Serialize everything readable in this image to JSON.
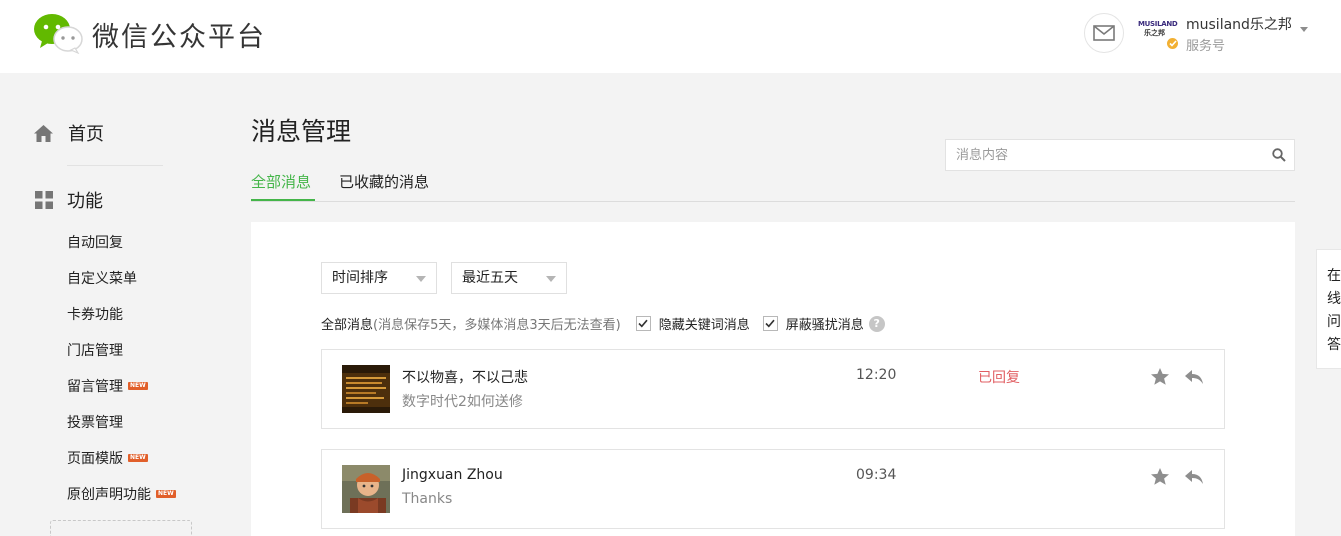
{
  "header": {
    "brand": "微信公众平台",
    "account": {
      "logo_line1": "MUSILAND",
      "logo_line2": "乐之邦",
      "name": "musiland乐之邦",
      "type": "服务号"
    }
  },
  "sidebar": {
    "home": {
      "label": "首页",
      "icon": "home-icon"
    },
    "features": {
      "label": "功能",
      "icon": "grid-icon"
    },
    "items": [
      {
        "label": "自动回复",
        "new": false
      },
      {
        "label": "自定义菜单",
        "new": false
      },
      {
        "label": "卡券功能",
        "new": false
      },
      {
        "label": "门店管理",
        "new": false
      },
      {
        "label": "留言管理",
        "new": true
      },
      {
        "label": "投票管理",
        "new": false
      },
      {
        "label": "页面模版",
        "new": true
      },
      {
        "label": "原创声明功能",
        "new": true
      }
    ],
    "new_badge": "NEW"
  },
  "main": {
    "title": "消息管理",
    "tabs": [
      {
        "label": "全部消息",
        "active": true
      },
      {
        "label": "已收藏的消息",
        "active": false
      }
    ],
    "search": {
      "placeholder": "消息内容"
    },
    "filters": {
      "sort_value": "时间排序",
      "range_value": "最近五天",
      "all_label": "全部消息",
      "note": "(消息保存5天，多媒体消息3天后无法查看)",
      "hide_keyword_label": "隐藏关键词消息",
      "hide_keyword_checked": true,
      "block_spam_label": "屏蔽骚扰消息",
      "block_spam_checked": true,
      "help": "?"
    },
    "messages": [
      {
        "name": "不以物喜，不以己悲",
        "content": "数字时代2如何送修",
        "time": "12:20",
        "status": "已回复"
      },
      {
        "name": "Jingxuan Zhou",
        "content": "Thanks",
        "time": "09:34",
        "status": ""
      }
    ]
  },
  "float_tab": {
    "chars": [
      "在",
      "线",
      "问",
      "答"
    ]
  },
  "colors": {
    "accent": "#44b549",
    "replied": "#e15f63",
    "new_badge": "#e15f2a"
  }
}
